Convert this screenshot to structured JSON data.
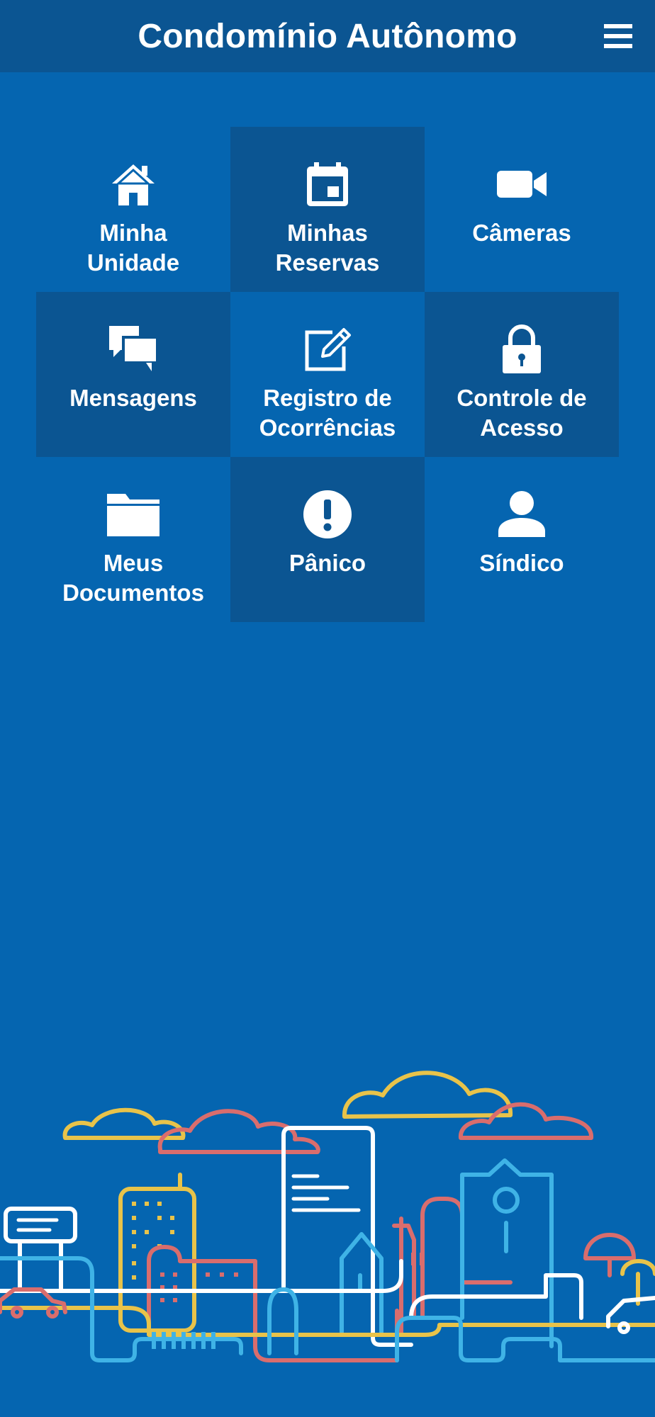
{
  "header": {
    "title": "Condomínio Autônomo",
    "menu_icon": "hamburger-menu-icon"
  },
  "menu": [
    {
      "id": "minha-unidade",
      "label": "Minha\nUnidade",
      "icon": "home-icon",
      "highlight": false
    },
    {
      "id": "minhas-reservas",
      "label": "Minhas\nReservas",
      "icon": "calendar-icon",
      "highlight": true
    },
    {
      "id": "cameras",
      "label": "Câmeras",
      "icon": "video-camera-icon",
      "highlight": false
    },
    {
      "id": "mensagens",
      "label": "Mensagens",
      "icon": "chat-bubbles-icon",
      "highlight": true
    },
    {
      "id": "registro-ocorrencias",
      "label": "Registro de\nOcorrências",
      "icon": "edit-note-icon",
      "highlight": false
    },
    {
      "id": "controle-acesso",
      "label": "Controle de\nAcesso",
      "icon": "padlock-icon",
      "highlight": true
    },
    {
      "id": "meus-documentos",
      "label": "Meus\nDocumentos",
      "icon": "folder-icon",
      "highlight": false
    },
    {
      "id": "panico",
      "label": "Pânico",
      "icon": "alert-circle-icon",
      "highlight": true
    },
    {
      "id": "sindico",
      "label": "Síndico",
      "icon": "person-icon",
      "highlight": false
    }
  ],
  "colors": {
    "background": "#0565b0",
    "header": "#0b5592",
    "tile_highlight": "#0b5592",
    "illustration": [
      "#ffffff",
      "#e8c34a",
      "#d96d6d",
      "#3fb3e6"
    ]
  }
}
